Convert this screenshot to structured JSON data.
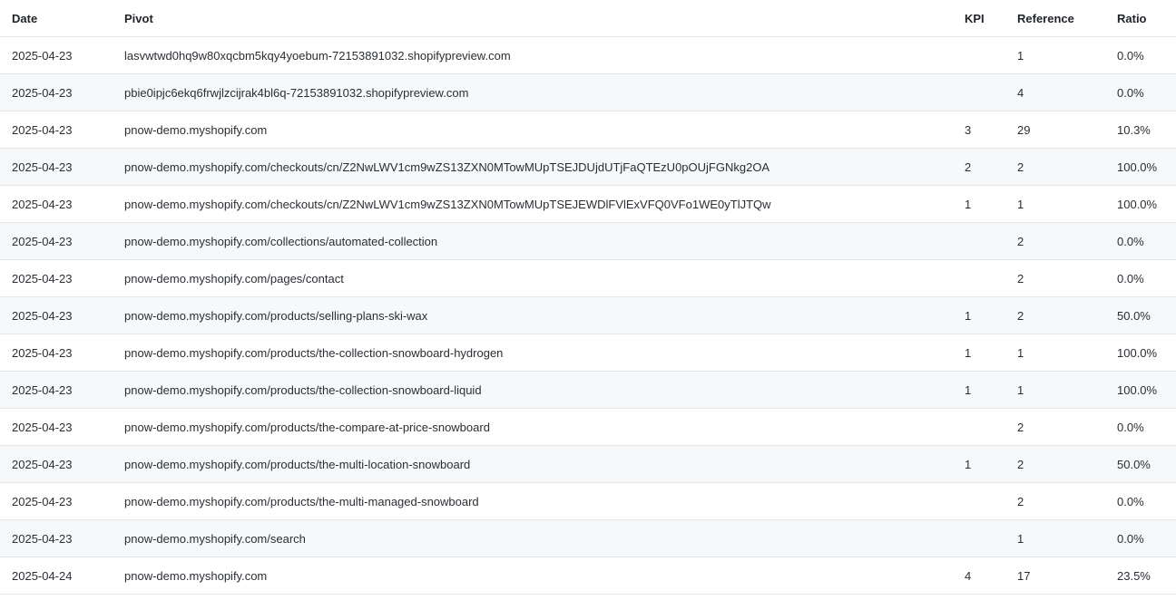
{
  "table": {
    "headers": {
      "date": "Date",
      "pivot": "Pivot",
      "kpi": "KPI",
      "reference": "Reference",
      "ratio": "Ratio"
    },
    "rows": [
      {
        "date": "2025-04-23",
        "pivot": "lasvwtwd0hq9w80xqcbm5kqy4yoebum-72153891032.shopifypreview.com",
        "kpi": "",
        "reference": "1",
        "ratio": "0.0%"
      },
      {
        "date": "2025-04-23",
        "pivot": "pbie0ipjc6ekq6frwjlzcijrak4bl6q-72153891032.shopifypreview.com",
        "kpi": "",
        "reference": "4",
        "ratio": "0.0%"
      },
      {
        "date": "2025-04-23",
        "pivot": "pnow-demo.myshopify.com",
        "kpi": "3",
        "reference": "29",
        "ratio": "10.3%"
      },
      {
        "date": "2025-04-23",
        "pivot": "pnow-demo.myshopify.com/checkouts/cn/Z2NwLWV1cm9wZS13ZXN0MTowMUpTSEJDUjdUTjFaQTEzU0pOUjFGNkg2OA",
        "kpi": "2",
        "reference": "2",
        "ratio": "100.0%"
      },
      {
        "date": "2025-04-23",
        "pivot": "pnow-demo.myshopify.com/checkouts/cn/Z2NwLWV1cm9wZS13ZXN0MTowMUpTSEJEWDlFVlExVFQ0VFo1WE0yTlJTQw",
        "kpi": "1",
        "reference": "1",
        "ratio": "100.0%"
      },
      {
        "date": "2025-04-23",
        "pivot": "pnow-demo.myshopify.com/collections/automated-collection",
        "kpi": "",
        "reference": "2",
        "ratio": "0.0%"
      },
      {
        "date": "2025-04-23",
        "pivot": "pnow-demo.myshopify.com/pages/contact",
        "kpi": "",
        "reference": "2",
        "ratio": "0.0%"
      },
      {
        "date": "2025-04-23",
        "pivot": "pnow-demo.myshopify.com/products/selling-plans-ski-wax",
        "kpi": "1",
        "reference": "2",
        "ratio": "50.0%"
      },
      {
        "date": "2025-04-23",
        "pivot": "pnow-demo.myshopify.com/products/the-collection-snowboard-hydrogen",
        "kpi": "1",
        "reference": "1",
        "ratio": "100.0%"
      },
      {
        "date": "2025-04-23",
        "pivot": "pnow-demo.myshopify.com/products/the-collection-snowboard-liquid",
        "kpi": "1",
        "reference": "1",
        "ratio": "100.0%"
      },
      {
        "date": "2025-04-23",
        "pivot": "pnow-demo.myshopify.com/products/the-compare-at-price-snowboard",
        "kpi": "",
        "reference": "2",
        "ratio": "0.0%"
      },
      {
        "date": "2025-04-23",
        "pivot": "pnow-demo.myshopify.com/products/the-multi-location-snowboard",
        "kpi": "1",
        "reference": "2",
        "ratio": "50.0%"
      },
      {
        "date": "2025-04-23",
        "pivot": "pnow-demo.myshopify.com/products/the-multi-managed-snowboard",
        "kpi": "",
        "reference": "2",
        "ratio": "0.0%"
      },
      {
        "date": "2025-04-23",
        "pivot": "pnow-demo.myshopify.com/search",
        "kpi": "",
        "reference": "1",
        "ratio": "0.0%"
      },
      {
        "date": "2025-04-24",
        "pivot": "pnow-demo.myshopify.com",
        "kpi": "4",
        "reference": "17",
        "ratio": "23.5%"
      }
    ]
  }
}
